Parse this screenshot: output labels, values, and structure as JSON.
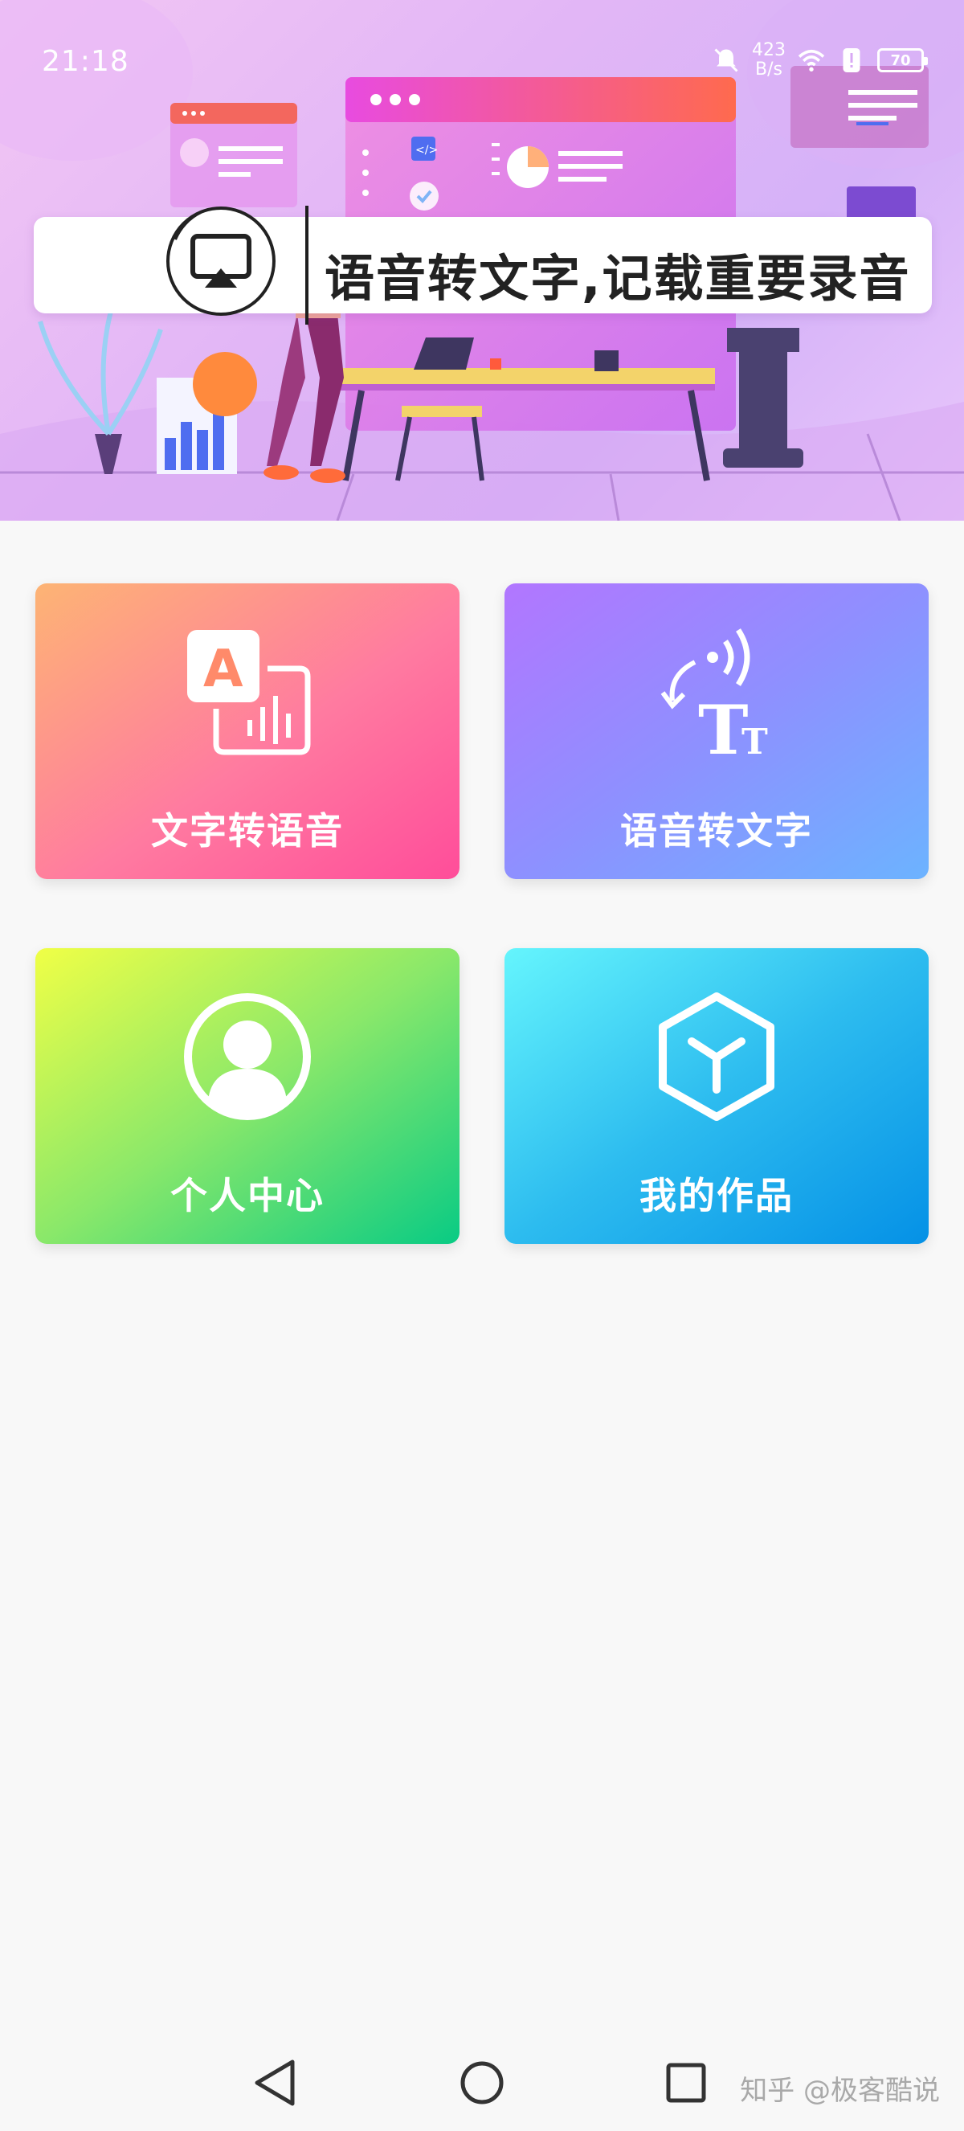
{
  "status_bar": {
    "time": "21:18",
    "net_speed_value": "423",
    "net_speed_unit": "B/s",
    "battery": "70"
  },
  "banner": {
    "caption": "语音转文字,记载重要录音",
    "airplay_icon": "airplay-icon",
    "code_tag": "</>"
  },
  "cards": [
    {
      "label": "文字转语音",
      "icon": "text-to-speech-icon"
    },
    {
      "label": "语音转文字",
      "icon": "speech-to-text-icon"
    },
    {
      "label": "个人中心",
      "icon": "user-icon"
    },
    {
      "label": "我的作品",
      "icon": "cube-icon"
    }
  ],
  "watermark": "知乎 @极客酷说",
  "colors": {
    "page_bg": "#f8f8f8",
    "card_tts": "#ff6e9c",
    "card_stt": "#8e90ff",
    "card_user": "#8ae86a",
    "card_works": "#2dbcef"
  }
}
